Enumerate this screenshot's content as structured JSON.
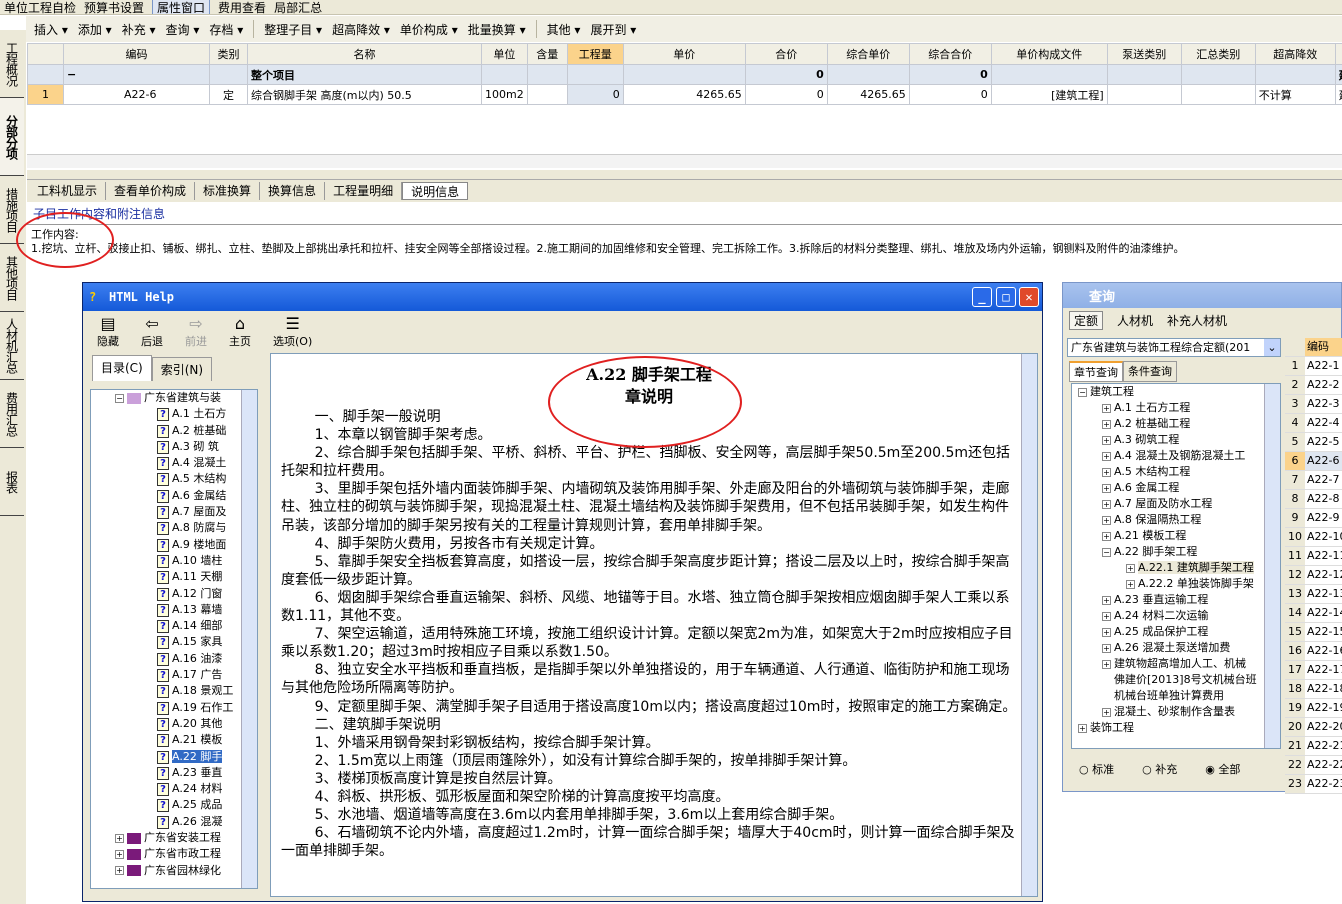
{
  "toolbar_top": {
    "items": [
      "单位工程自检",
      "预算书设置",
      "属性窗口",
      "费用查看",
      "局部汇总"
    ],
    "pressed": "属性窗口"
  },
  "toolbar": {
    "items": [
      "插入 ▾",
      "添加 ▾",
      "补充 ▾",
      "查询 ▾",
      "存档 ▾",
      "整理子目 ▾",
      "超高降效 ▾",
      "单价构成 ▾",
      "批量换算 ▾",
      "其他 ▾",
      "展开到 ▾"
    ]
  },
  "side_tabs": [
    "工程概况",
    "分部分项",
    "措施项目",
    "其他项目",
    "人材机汇总",
    "费用汇总",
    "报表"
  ],
  "side_active": "分部分项",
  "grid": {
    "columns": [
      "",
      "编码",
      "类别",
      "名称",
      "单位",
      "含量",
      "工程量",
      "单价",
      "合价",
      "综合单价",
      "综合合价",
      "单价构成文件",
      "泵送类别",
      "汇总类别",
      "超高降效",
      ""
    ],
    "group_row": {
      "toggle": "−",
      "name": "整个项目",
      "hejia": "0",
      "zonghe_hejia": "0",
      "last": "建筑物超"
    },
    "rows": [
      {
        "no": "1",
        "code": "A22-6",
        "type": "定",
        "name": "综合钢脚手架 高度(m以内) 50.5",
        "unit": "100m2",
        "content": "",
        "qty": "0",
        "price": "4265.65",
        "total": "0",
        "unit_price": "4265.65",
        "unit_total": "0",
        "file": "[建筑工程]",
        "pump": "",
        "sum_type": "",
        "super": "不计算",
        "last": "建筑物超"
      }
    ]
  },
  "bottom_tabs": [
    "工料机显示",
    "查看单价构成",
    "标准换算",
    "换算信息",
    "工程量明细",
    "说明信息"
  ],
  "bottom_active": "说明信息",
  "info_link": "子目工作内容和附注信息",
  "work_content_label": "工作内容:",
  "work_content": "1.挖坑、立杆、驳接止扣、铺板、绑扎、立柱、垫脚及上部挑出承托和拉杆、挂安全网等全部搭设过程。2.施工期间的加固维修和安全管理、完工拆除工作。3.拆除后的材料分类整理、绑扎、堆放及场内外运输，钢铡料及附件的油漆维护。",
  "help": {
    "title": "HTML Help",
    "tools": [
      {
        "icon": "hide-icon",
        "glyph": "▤",
        "label": "隐藏"
      },
      {
        "icon": "back-icon",
        "glyph": "⇦",
        "label": "后退"
      },
      {
        "icon": "forward-icon",
        "glyph": "⇨",
        "label": "前进",
        "disabled": true
      },
      {
        "icon": "home-icon",
        "glyph": "⌂",
        "label": "主页"
      },
      {
        "icon": "options-icon",
        "glyph": "☰",
        "label": "选项(O)"
      }
    ],
    "tabs": [
      "目录(C)",
      "索引(N)"
    ],
    "tree_root": "广东省建筑与装",
    "tree_items": [
      "A.1  土石方",
      "A.2  桩基础",
      "A.3  砌  筑",
      "A.4  混凝土",
      "A.5  木结构",
      "A.6  金属结",
      "A.7 屋面及",
      "A.8  防腐与",
      "A.9  楼地面",
      "A.10  墙柱",
      "A.11  天棚",
      "A.12  门窗",
      "A.13  幕墙",
      "A.14  细部",
      "A.15  家具",
      "A.16  油漆",
      "A.17  广告",
      "A.18 景观工",
      "A.19 石作工",
      "A.20  其他",
      "A.21  模板",
      "A.22  脚手",
      "A.23  垂直",
      "A.24  材料",
      "A.25  成品",
      "A.26  混凝"
    ],
    "tree_selected": 21,
    "tree_books": [
      "广东省安装工程",
      "广东省市政工程",
      "广东省园林绿化"
    ],
    "content_title": "A.22  脚手架工程",
    "content_subtitle": "章说明",
    "paragraphs": [
      "一、脚手架一般说明",
      "1、本章以钢管脚手架考虑。",
      "2、综合脚手架包括脚手架、平桥、斜桥、平台、护栏、挡脚板、安全网等，高层脚手架50.5m至200.5m还包括托架和拉杆费用。",
      "3、里脚手架包括外墙内面装饰脚手架、内墙砌筑及装饰用脚手架、外走廊及阳台的外墙砌筑与装饰脚手架，走廊柱、独立柱的砌筑与装饰脚手架，现捣混凝土柱、混凝土墙结构及装饰脚手架费用，但不包括吊装脚手架，如发生构件吊装，该部分增加的脚手架另按有关的工程量计算规则计算，套用单排脚手架。",
      "4、脚手架防火费用，另按各市有关规定计算。",
      "5、靠脚手架安全挡板套算高度，如搭设一层，按综合脚手架高度步距计算；搭设二层及以上时，按综合脚手架高度套低一级步距计算。",
      "6、烟囱脚手架综合垂直运输架、斜桥、风缆、地锚等于目。水塔、独立筒仓脚手架按相应烟囱脚手架人工乘以系数1.11，其他不变。",
      "7、架空运输道，适用特殊施工环境，按施工组织设计计算。定额以架宽2m为准，如架宽大于2m时应按相应子目乘以系数1.20；超过3m时按相应子目乘以系数1.50。",
      "8、独立安全水平挡板和垂直挡板，是指脚手架以外单独搭设的，用于车辆通道、人行通道、临街防护和施工现场与其他危险场所隔离等防护。",
      "9、定额里脚手架、满堂脚手架子目适用于搭设高度10m以内；搭设高度超过10m时，按照审定的施工方案确定。",
      "二、建筑脚手架说明",
      "1、外墙采用钢骨架封彩钢板结构，按综合脚手架计算。",
      "2、1.5m宽以上雨篷（顶层雨篷除外），如没有计算综合脚手架的，按单排脚手架计算。",
      "3、楼梯顶板高度计算是按自然层计算。",
      "4、斜板、拱形板、弧形板屋面和架空阶梯的计算高度按平均高度。",
      "5、水池墙、烟道墙等高度在3.6m以内套用单排脚手架，3.6m以上套用综合脚手架。",
      "6、石墙砌筑不论内外墙，高度超过1.2m时，计算一面综合脚手架；墙厚大于40cm时，则计算一面综合脚手架及一面单排脚手架。"
    ]
  },
  "query": {
    "title": "查询",
    "tabs": [
      "定额",
      "人材机",
      "补充人材机"
    ],
    "quota_select": "广东省建筑与装饰工程综合定额(201",
    "subtabs": [
      "章节查询",
      "条件查询"
    ],
    "tree": [
      {
        "l": 0,
        "pm": "−",
        "t": "建筑工程"
      },
      {
        "l": 1,
        "pm": "+",
        "t": "A.1  土石方工程"
      },
      {
        "l": 1,
        "pm": "+",
        "t": "A.2  桩基础工程"
      },
      {
        "l": 1,
        "pm": "+",
        "t": "A.3  砌筑工程"
      },
      {
        "l": 1,
        "pm": "+",
        "t": "A.4  混凝土及钢筋混凝土工"
      },
      {
        "l": 1,
        "pm": "+",
        "t": "A.5  木结构工程"
      },
      {
        "l": 1,
        "pm": "+",
        "t": "A.6  金属工程"
      },
      {
        "l": 1,
        "pm": "+",
        "t": "A.7  屋面及防水工程"
      },
      {
        "l": 1,
        "pm": "+",
        "t": "A.8  保温隔热工程"
      },
      {
        "l": 1,
        "pm": "+",
        "t": "A.21  模板工程"
      },
      {
        "l": 1,
        "pm": "−",
        "t": "A.22  脚手架工程"
      },
      {
        "l": 2,
        "pm": "+",
        "t": "A.22.1  建筑脚手架工程",
        "sel": true
      },
      {
        "l": 2,
        "pm": "+",
        "t": "A.22.2  单独装饰脚手架"
      },
      {
        "l": 1,
        "pm": "+",
        "t": "A.23  垂直运输工程"
      },
      {
        "l": 1,
        "pm": "+",
        "t": "A.24  材料二次运输"
      },
      {
        "l": 1,
        "pm": "+",
        "t": "A.25  成品保护工程"
      },
      {
        "l": 1,
        "pm": "+",
        "t": "A.26  混凝土泵送增加费"
      },
      {
        "l": 1,
        "pm": "+",
        "t": "建筑物超高增加人工、机械"
      },
      {
        "l": 1,
        "pm": "",
        "t": "佛建价[2013]8号文机械台班"
      },
      {
        "l": 1,
        "pm": "",
        "t": "机械台班单独计算费用"
      },
      {
        "l": 1,
        "pm": "+",
        "t": "混凝土、砂浆制作含量表"
      },
      {
        "l": 0,
        "pm": "+",
        "t": "装饰工程"
      }
    ],
    "radios": [
      "标准",
      "补充",
      "全部"
    ],
    "radio_selected": "全部",
    "grid_header": "编码",
    "grid_rows": [
      "A22-1",
      "A22-2",
      "A22-3",
      "A22-4",
      "A22-5",
      "A22-6",
      "A22-7",
      "A22-8",
      "A22-9",
      "A22-10",
      "A22-11",
      "A22-12",
      "A22-13",
      "A22-14",
      "A22-15",
      "A22-16",
      "A22-17",
      "A22-18",
      "A22-19",
      "A22-20",
      "A22-21",
      "A22-22",
      "A22-23"
    ],
    "grid_selected": 5
  },
  "colors": {
    "accent_orange": "#fbd38b",
    "annotation_red": "#e02020",
    "title_blue": "#1459d8"
  }
}
